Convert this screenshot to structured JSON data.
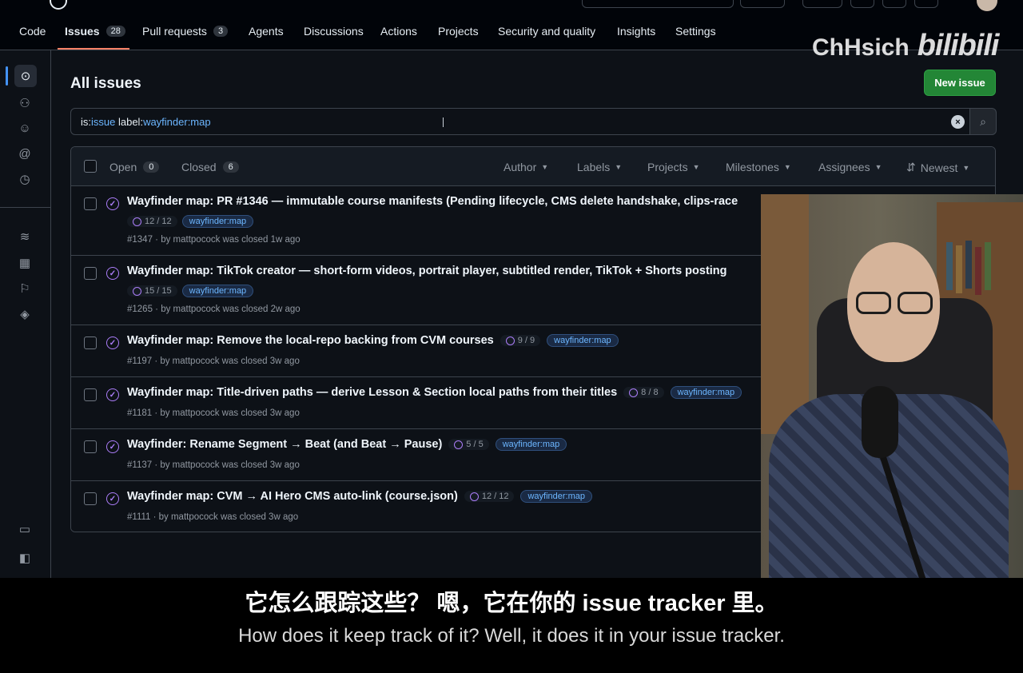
{
  "nav": {
    "items": [
      {
        "label": "Code"
      },
      {
        "label": "Issues",
        "count": "28"
      },
      {
        "label": "Pull requests",
        "count": "3"
      },
      {
        "label": "Agents"
      },
      {
        "label": "Discussions"
      },
      {
        "label": "Actions"
      },
      {
        "label": "Projects"
      },
      {
        "label": "Security and quality"
      },
      {
        "label": "Insights"
      },
      {
        "label": "Settings"
      }
    ]
  },
  "watermark": {
    "user": "ChHsich",
    "brand": "bilibili"
  },
  "page": {
    "title": "All issues",
    "new_issue_label": "New issue"
  },
  "search": {
    "kw1": "is:",
    "val1": "issue",
    "kw2": " label:",
    "val2": "wayfinder:map"
  },
  "filters": {
    "open_label": "Open",
    "open_count": "0",
    "closed_label": "Closed",
    "closed_count": "6",
    "author": "Author",
    "labels": "Labels",
    "projects": "Projects",
    "milestones": "Milestones",
    "assignees": "Assignees",
    "sort": "Newest"
  },
  "issues": [
    {
      "title": "Wayfinder map: PR #1346 — immutable course manifests (Pending lifecycle, CMS delete handshake, clips-race",
      "progress": "12 / 12",
      "label": "wayfinder:map",
      "meta": "#1347 · by mattpocock was closed 1w ago"
    },
    {
      "title": "Wayfinder map: TikTok creator — short-form videos, portrait player, subtitled render, TikTok + Shorts posting",
      "progress": "15 / 15",
      "label": "wayfinder:map",
      "meta": "#1265 · by mattpocock was closed 2w ago"
    },
    {
      "title": "Wayfinder map: Remove the local-repo backing from CVM courses",
      "progress": "9 / 9",
      "label": "wayfinder:map",
      "meta": "#1197 · by mattpocock was closed 3w ago"
    },
    {
      "title": "Wayfinder map: Title-driven paths — derive Lesson & Section local paths from their titles",
      "progress": "8 / 8",
      "label": "wayfinder:map",
      "meta": "#1181 · by mattpocock was closed 3w ago"
    },
    {
      "title": "Wayfinder: Rename Segment → Beat (and Beat → Pause)",
      "progress": "5 / 5",
      "label": "wayfinder:map",
      "meta": "#1137 · by mattpocock was closed 3w ago"
    },
    {
      "title": "Wayfinder map: CVM → AI Hero CMS auto-link (course.json)",
      "progress": "12 / 12",
      "label": "wayfinder:map",
      "meta": "#1111 · by mattpocock was closed 3w ago"
    }
  ],
  "subtitles": {
    "zh": "它怎么跟踪这些？ 嗯，它在你的 issue tracker 里。",
    "en": "How does it keep track of it? Well, it does it in your issue tracker."
  },
  "colors": {
    "accent": "#4493f8",
    "closed": "#ab7df8",
    "new_issue": "#238636",
    "label_text": "#6cb6ff"
  }
}
